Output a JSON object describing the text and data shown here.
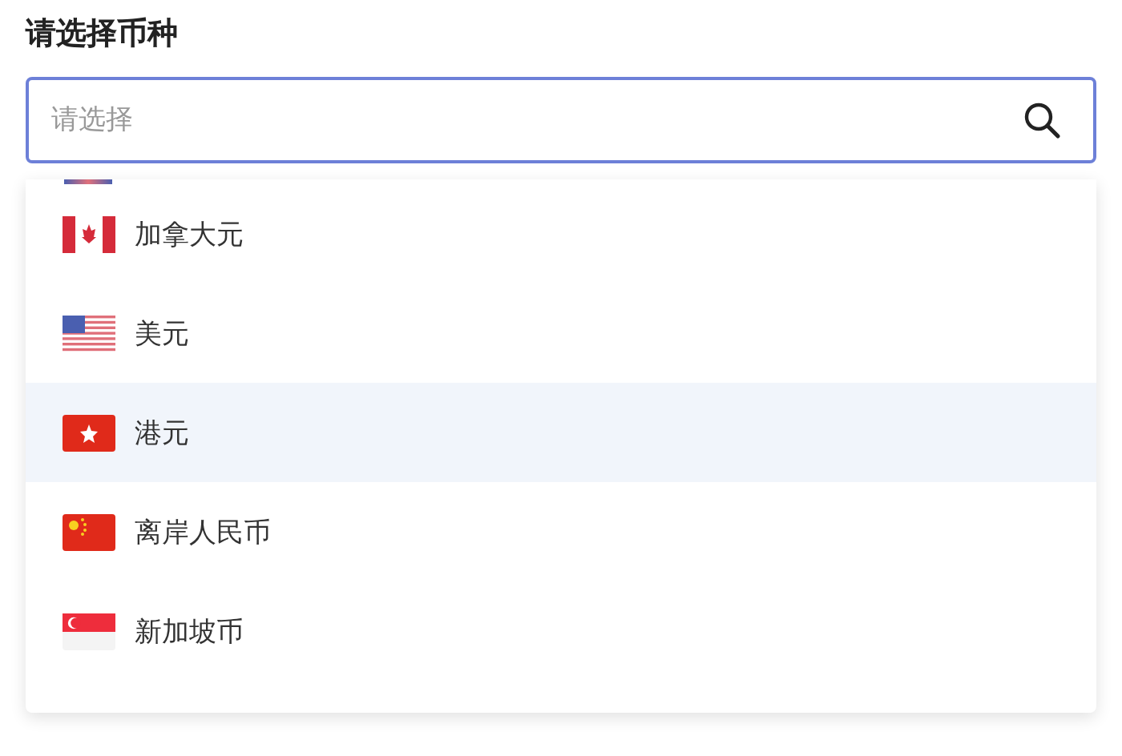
{
  "label": "请选择币种",
  "search": {
    "placeholder": "请选择"
  },
  "options": [
    {
      "kind": "ca",
      "name": "加拿大元",
      "selected": false
    },
    {
      "kind": "us",
      "name": "美元",
      "selected": false
    },
    {
      "kind": "hk",
      "name": "港元",
      "selected": true
    },
    {
      "kind": "cn",
      "name": "离岸人民币",
      "selected": false
    },
    {
      "kind": "sg",
      "name": "新加坡币",
      "selected": false
    }
  ]
}
